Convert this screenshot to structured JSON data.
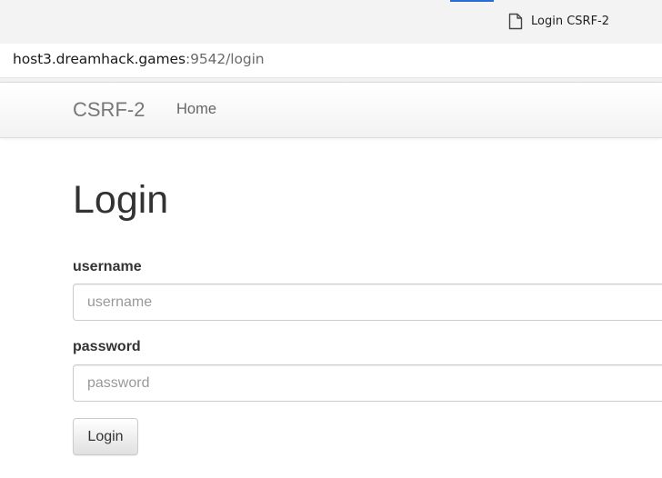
{
  "browser": {
    "tab": {
      "title": "Login CSRF-2",
      "icon": "page-icon"
    },
    "address_bar": {
      "host": "host3.dreamhack.games",
      "path": ":9542/login"
    },
    "accent_color": "#2a6cd6"
  },
  "navbar": {
    "brand": "CSRF-2",
    "links": [
      {
        "label": "Home"
      }
    ]
  },
  "main": {
    "title": "Login",
    "form": {
      "username": {
        "label": "username",
        "placeholder": "username",
        "value": ""
      },
      "password": {
        "label": "password",
        "placeholder": "password",
        "value": ""
      },
      "submit_label": "Login"
    }
  }
}
